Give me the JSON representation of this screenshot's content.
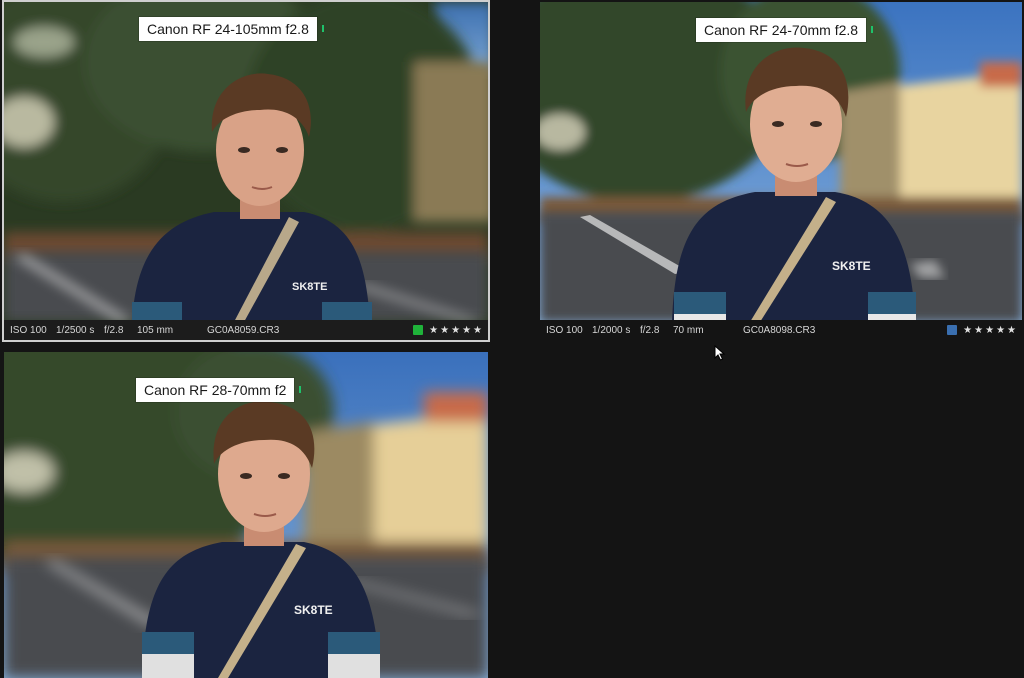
{
  "panels": [
    {
      "lens": "Canon RF 24-105mm f2.8",
      "iso": "ISO 100",
      "shutter": "1/2500 s",
      "aperture": "f/2.8",
      "focal": "105 mm",
      "filename": "GC0A8059.CR3",
      "color_label": "#1fb33a",
      "rating": "★★★★★",
      "selected": true
    },
    {
      "lens": "Canon RF 24-70mm f2.8",
      "iso": "ISO 100",
      "shutter": "1/2000 s",
      "aperture": "f/2.8",
      "focal": "70 mm",
      "filename": "GC0A8098.CR3",
      "color_label": "#3a6fb0",
      "rating": "★★★★★",
      "selected": false
    },
    {
      "lens": "Canon RF 28-70mm f2",
      "selected": false
    }
  ],
  "shirt_text": "SK8TE",
  "colors": {
    "background": "#141414",
    "meta_bar": "#1c1c1c",
    "selection_border": "#cfcfcf"
  }
}
